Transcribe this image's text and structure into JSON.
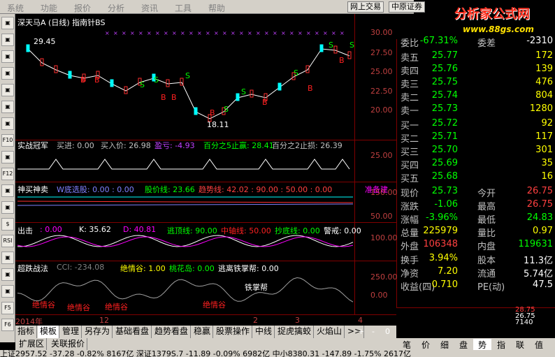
{
  "menu": [
    "系统",
    "功能",
    "报价",
    "分析",
    "资讯",
    "工具",
    "帮助"
  ],
  "top_buttons": [
    "网上交易",
    "中原证券"
  ],
  "brand": {
    "name": "分析家公式网",
    "url": "www.88gs.com"
  },
  "toolbar_icons": [
    "grid-icon",
    "list-icon",
    "kline-icon",
    "line-icon",
    "bar-icon",
    "window-icon",
    "table-icon",
    "F10",
    "doc-icon",
    "F12",
    "zoom-icon",
    "chart-icon",
    "$",
    "RSI",
    "money-icon",
    "news-icon",
    "pen-icon",
    "F5",
    "F6"
  ],
  "stock": {
    "name": "深天马A",
    "period": "(日线)",
    "indicator": "指南针BS",
    "high_mark": "29.45",
    "low_mark": "18.11"
  },
  "price_axis": [
    "30.00",
    "27.50",
    "25.00",
    "22.50",
    "20.00"
  ],
  "panels": {
    "p1": {
      "title": "实战冠军",
      "items": [
        {
          "k": "买进:",
          "v": "0.00",
          "c": "#c0c0c0"
        },
        {
          "k": "买入价:",
          "v": "26.98",
          "c": "#c0c0c0"
        },
        {
          "k": "盈亏:",
          "v": "-4.93",
          "c": "#c040ff"
        },
        {
          "k": "百分之5止赢:",
          "v": "28.41",
          "c": "#00ff00"
        },
        {
          "k": "百分之2止损:",
          "v": "26.39",
          "c": "#c0c0c0"
        }
      ],
      "axis": [
        "25.00"
      ]
    },
    "p2": {
      "title": "神买神卖",
      "items": [
        {
          "k": "W底选股:",
          "v": "0.00 : 0.00",
          "c": "#8080ff"
        },
        {
          "k": "股价线:",
          "v": "23.66",
          "c": "#00ff00"
        },
        {
          "k": "趋势线:",
          "v": "42.02 : 90.00 : 50.00 : 0.00",
          "c": "#ff4040"
        },
        {
          "k": "准备建",
          "v": "",
          "c": "#ff00ff"
        }
      ],
      "axis": [
        "150.00",
        "50.00"
      ]
    },
    "p3": {
      "title": "出击",
      "items": [
        {
          "k": "",
          "v": ": 0.00",
          "c": "#ff00ff"
        },
        {
          "k": "K:",
          "v": "35.62",
          "c": "#ffffff"
        },
        {
          "k": "D:",
          "v": "40.81",
          "c": "#ff00ff"
        },
        {
          "k": "逃顶线:",
          "v": "90.00",
          "c": "#00ff00"
        },
        {
          "k": "中轴线:",
          "v": "50.00",
          "c": "#ff2020"
        },
        {
          "k": "抄底线:",
          "v": "0.00",
          "c": "#00ff00"
        },
        {
          "k": "警戒:",
          "v": "0.00",
          "c": "#ffffff"
        }
      ],
      "axis": [
        "100.00"
      ]
    },
    "p4": {
      "title": "超跌战法",
      "items": [
        {
          "k": "CCI:",
          "v": "-234.08",
          "c": "#808080"
        },
        {
          "k": "绝情谷:",
          "v": "1.00",
          "c": "#ffff00"
        },
        {
          "k": "桃花岛:",
          "v": "0.00",
          "c": "#00ff00"
        },
        {
          "k": "逃离铁掌帮:",
          "v": "0.00",
          "c": "#ffffff"
        }
      ],
      "axis": [
        "250.00",
        "0.00"
      ],
      "label": "铁掌帮",
      "notes": [
        "绝情谷",
        "绝情谷",
        "绝情谷",
        "绝情谷"
      ]
    }
  },
  "dates": [
    "2014年",
    "12",
    "2",
    "3",
    "4"
  ],
  "quote": {
    "wb": {
      "k": "委比",
      "v": "-67.31%",
      "k2": "委差",
      "v2": "-2310"
    },
    "asks": [
      {
        "k": "卖五",
        "p": "25.77",
        "q": "172"
      },
      {
        "k": "卖四",
        "p": "25.76",
        "q": "139"
      },
      {
        "k": "卖三",
        "p": "25.75",
        "q": "476"
      },
      {
        "k": "卖二",
        "p": "25.74",
        "q": "804"
      },
      {
        "k": "卖一",
        "p": "25.73",
        "q": "1280"
      }
    ],
    "bids": [
      {
        "k": "买一",
        "p": "25.72",
        "q": "92"
      },
      {
        "k": "买二",
        "p": "25.71",
        "q": "117"
      },
      {
        "k": "买三",
        "p": "25.70",
        "q": "301"
      },
      {
        "k": "买四",
        "p": "25.69",
        "q": "35"
      },
      {
        "k": "买五",
        "p": "25.68",
        "q": "16"
      }
    ],
    "stats": [
      {
        "k": "现价",
        "v": "25.73",
        "c": "#00ff00",
        "k2": "今开",
        "v2": "26.75",
        "c2": "#ff4040"
      },
      {
        "k": "涨跌",
        "v": "-1.06",
        "c": "#00ff00",
        "k2": "最高",
        "v2": "26.75",
        "c2": "#ff4040"
      },
      {
        "k": "涨幅",
        "v": "-3.96%",
        "c": "#00ff00",
        "k2": "最低",
        "v2": "24.83",
        "c2": "#00ff00"
      },
      {
        "k": "总量",
        "v": "225979",
        "c": "#ffff00",
        "k2": "量比",
        "v2": "0.97",
        "c2": "#ffff00"
      },
      {
        "k": "外盘",
        "v": "106348",
        "c": "#ff4040",
        "k2": "内盘",
        "v2": "119631",
        "c2": "#00ff00"
      }
    ],
    "stats2": [
      {
        "k": "换手",
        "v": "3.94%",
        "k2": "股本",
        "v2": "11.3亿"
      },
      {
        "k": "净资",
        "v": "7.20",
        "k2": "流通",
        "v2": "5.74亿"
      },
      {
        "k": "收益(四)",
        "v": "0.710",
        "k2": "PE(动)",
        "v2": "47.5"
      }
    ]
  },
  "mini": {
    "label": "日线",
    "plus": "+",
    "minus": "-",
    "zero": "0",
    "vals": [
      "28.75",
      "26.75",
      "7140"
    ]
  },
  "bottom_tabs": [
    "指标",
    "模板",
    "管理",
    "另存为",
    "基础看盘",
    "趋势看盘",
    "稳赢",
    "股票操作",
    "中线",
    "捉虎擒蛟",
    "火焰山",
    ">>"
  ],
  "ext_tabs": [
    "扩展区",
    "关联报价"
  ],
  "right_tabs": [
    "笔",
    "价",
    "细",
    "盘",
    "势",
    "指",
    "联",
    "值"
  ],
  "status": "上证2957.52 -37.28 -0.82% 8167亿  深证1379S.7 -11.89 -0.09% 6982亿  中小8380.31 -147.89 -1.75% 2617亿"
}
